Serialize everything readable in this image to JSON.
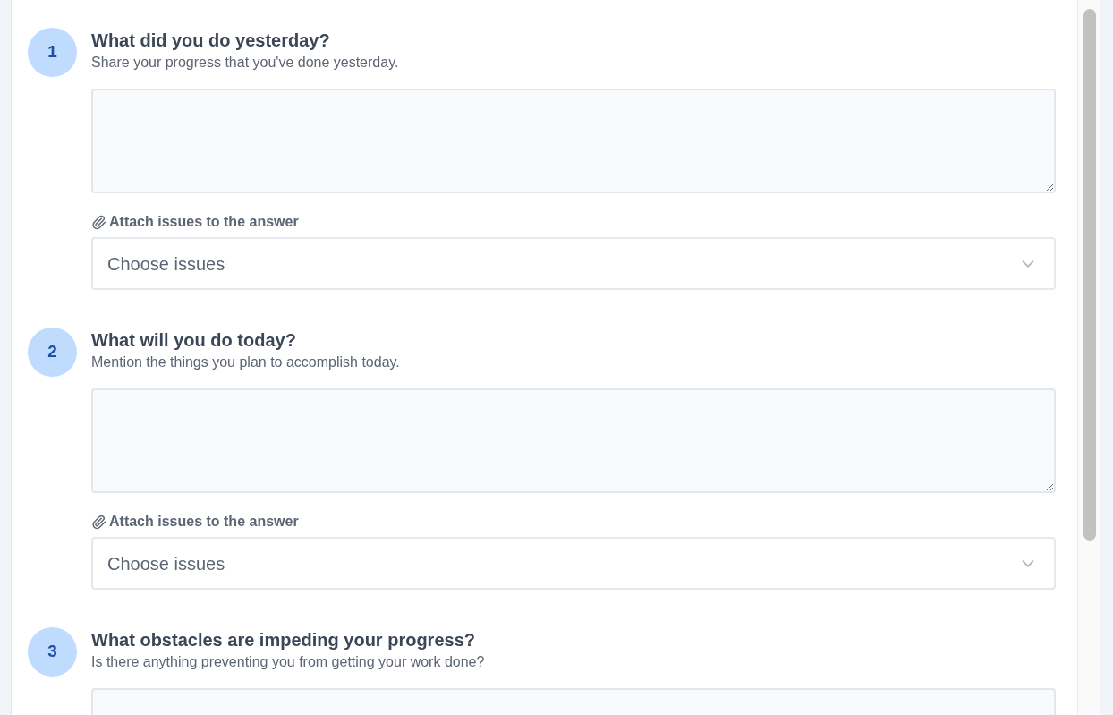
{
  "questions": [
    {
      "number": "1",
      "title": "What did you do yesterday?",
      "description": "Share your progress that you've done yesterday.",
      "attach": {
        "label": "Attach issues to the answer",
        "placeholder": "Choose issues"
      }
    },
    {
      "number": "2",
      "title": "What will you do today?",
      "description": "Mention the things you plan to accomplish today.",
      "attach": {
        "label": "Attach issues to the answer",
        "placeholder": "Choose issues"
      }
    },
    {
      "number": "3",
      "title": "What obstacles are impeding your progress?",
      "description": "Is there anything preventing you from getting your work done?"
    }
  ]
}
